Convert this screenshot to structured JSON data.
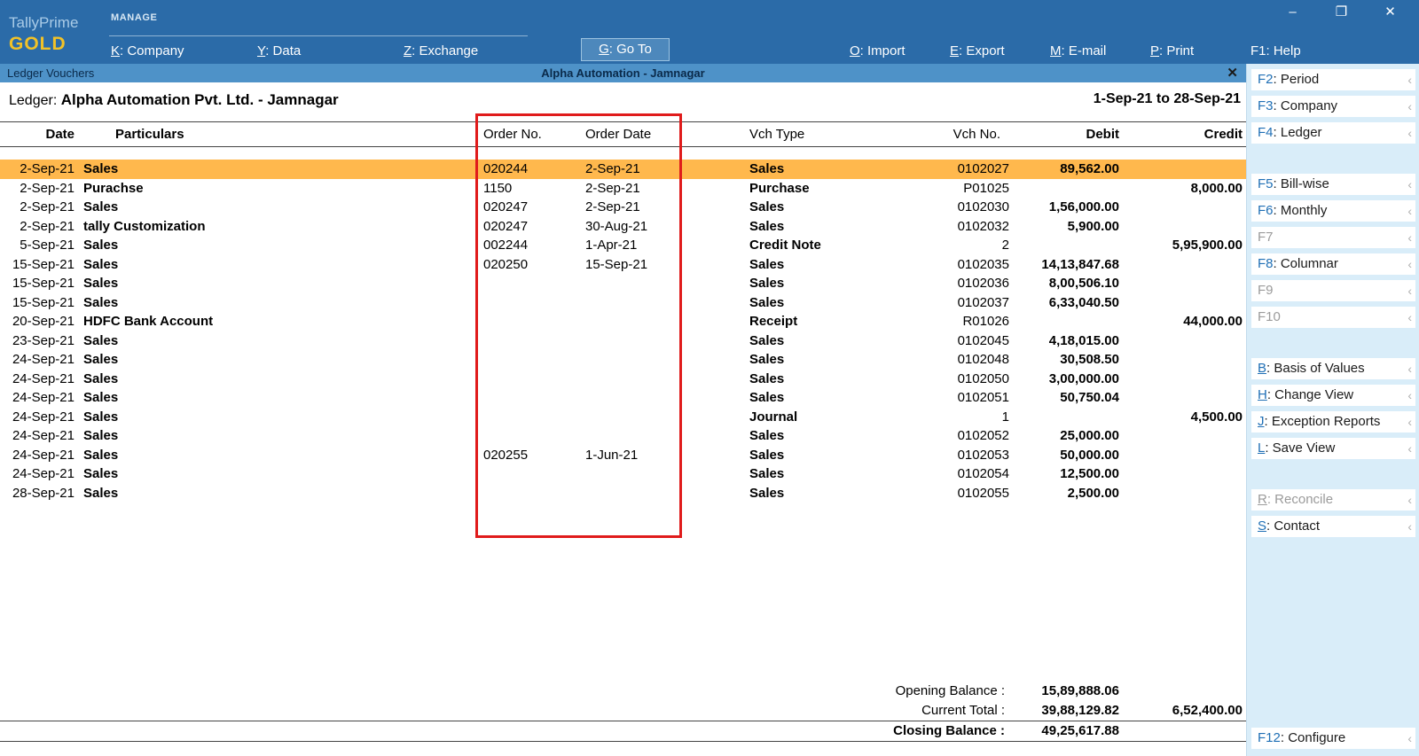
{
  "topbar": {
    "brand": {
      "name": "TallyPrime",
      "edition": "GOLD"
    },
    "section_label": "MANAGE",
    "left_menu": [
      {
        "key": "K",
        "label": "Company"
      },
      {
        "key": "Y",
        "label": "Data"
      },
      {
        "key": "Z",
        "label": "Exchange"
      }
    ],
    "goto": {
      "key": "G",
      "label": "Go To"
    },
    "right_menu": [
      {
        "key": "O",
        "label": "Import"
      },
      {
        "key": "E",
        "label": "Export"
      },
      {
        "key": "M",
        "label": "E-mail"
      },
      {
        "key": "P",
        "label": "Print"
      },
      {
        "key": "F1",
        "label": "Help"
      }
    ]
  },
  "window_controls": {
    "minimize": "–",
    "maximize": "❐",
    "close": "✕"
  },
  "titlebar": {
    "left": "Ledger Vouchers",
    "center": "Alpha Automation - Jamnagar",
    "close": "✕"
  },
  "report": {
    "ledger_label": "Ledger:",
    "ledger_name": "Alpha Automation Pvt. Ltd. - Jamnagar",
    "period": "1-Sep-21 to 28-Sep-21",
    "columns": [
      "Date",
      "Particulars",
      "Order No.",
      "Order Date",
      "Vch Type",
      "Vch No.",
      "Debit",
      "Credit"
    ],
    "rows": [
      {
        "date": "2-Sep-21",
        "particulars": "Sales",
        "order_no": "020244",
        "order_date": "2-Sep-21",
        "vch_type": "Sales",
        "vch_no": "0102027",
        "debit": "89,562.00",
        "credit": "",
        "highlighted": true
      },
      {
        "date": "2-Sep-21",
        "particulars": "Purachse",
        "order_no": "1150",
        "order_date": "2-Sep-21",
        "vch_type": "Purchase",
        "vch_no": "P01025",
        "debit": "",
        "credit": "8,000.00",
        "highlighted": false
      },
      {
        "date": "2-Sep-21",
        "particulars": "Sales",
        "order_no": "020247",
        "order_date": "2-Sep-21",
        "vch_type": "Sales",
        "vch_no": "0102030",
        "debit": "1,56,000.00",
        "credit": "",
        "highlighted": false
      },
      {
        "date": "2-Sep-21",
        "particulars": "tally Customization",
        "order_no": "020247",
        "order_date": "30-Aug-21",
        "vch_type": "Sales",
        "vch_no": "0102032",
        "debit": "5,900.00",
        "credit": "",
        "highlighted": false
      },
      {
        "date": "5-Sep-21",
        "particulars": "Sales",
        "order_no": "002244",
        "order_date": "1-Apr-21",
        "vch_type": "Credit Note",
        "vch_no": "2",
        "debit": "",
        "credit": "5,95,900.00",
        "highlighted": false
      },
      {
        "date": "15-Sep-21",
        "particulars": "Sales",
        "order_no": "020250",
        "order_date": "15-Sep-21",
        "vch_type": "Sales",
        "vch_no": "0102035",
        "debit": "14,13,847.68",
        "credit": "",
        "highlighted": false
      },
      {
        "date": "15-Sep-21",
        "particulars": "Sales",
        "order_no": "",
        "order_date": "",
        "vch_type": "Sales",
        "vch_no": "0102036",
        "debit": "8,00,506.10",
        "credit": "",
        "highlighted": false
      },
      {
        "date": "15-Sep-21",
        "particulars": "Sales",
        "order_no": "",
        "order_date": "",
        "vch_type": "Sales",
        "vch_no": "0102037",
        "debit": "6,33,040.50",
        "credit": "",
        "highlighted": false
      },
      {
        "date": "20-Sep-21",
        "particulars": "HDFC Bank Account",
        "order_no": "",
        "order_date": "",
        "vch_type": "Receipt",
        "vch_no": "R01026",
        "debit": "",
        "credit": "44,000.00",
        "highlighted": false
      },
      {
        "date": "23-Sep-21",
        "particulars": "Sales",
        "order_no": "",
        "order_date": "",
        "vch_type": "Sales",
        "vch_no": "0102045",
        "debit": "4,18,015.00",
        "credit": "",
        "highlighted": false
      },
      {
        "date": "24-Sep-21",
        "particulars": "Sales",
        "order_no": "",
        "order_date": "",
        "vch_type": "Sales",
        "vch_no": "0102048",
        "debit": "30,508.50",
        "credit": "",
        "highlighted": false
      },
      {
        "date": "24-Sep-21",
        "particulars": "Sales",
        "order_no": "",
        "order_date": "",
        "vch_type": "Sales",
        "vch_no": "0102050",
        "debit": "3,00,000.00",
        "credit": "",
        "highlighted": false
      },
      {
        "date": "24-Sep-21",
        "particulars": "Sales",
        "order_no": "",
        "order_date": "",
        "vch_type": "Sales",
        "vch_no": "0102051",
        "debit": "50,750.04",
        "credit": "",
        "highlighted": false
      },
      {
        "date": "24-Sep-21",
        "particulars": "Sales",
        "order_no": "",
        "order_date": "",
        "vch_type": "Journal",
        "vch_no": "1",
        "debit": "",
        "credit": "4,500.00",
        "highlighted": false
      },
      {
        "date": "24-Sep-21",
        "particulars": "Sales",
        "order_no": "",
        "order_date": "",
        "vch_type": "Sales",
        "vch_no": "0102052",
        "debit": "25,000.00",
        "credit": "",
        "highlighted": false
      },
      {
        "date": "24-Sep-21",
        "particulars": "Sales",
        "order_no": "020255",
        "order_date": "1-Jun-21",
        "vch_type": "Sales",
        "vch_no": "0102053",
        "debit": "50,000.00",
        "credit": "",
        "highlighted": false
      },
      {
        "date": "24-Sep-21",
        "particulars": "Sales",
        "order_no": "",
        "order_date": "",
        "vch_type": "Sales",
        "vch_no": "0102054",
        "debit": "12,500.00",
        "credit": "",
        "highlighted": false
      },
      {
        "date": "28-Sep-21",
        "particulars": "Sales",
        "order_no": "",
        "order_date": "",
        "vch_type": "Sales",
        "vch_no": "0102055",
        "debit": "2,500.00",
        "credit": "",
        "highlighted": false
      }
    ],
    "totals": {
      "opening": {
        "label": "Opening Balance :",
        "debit": "15,89,888.06",
        "credit": ""
      },
      "current": {
        "label": "Current Total :",
        "debit": "39,88,129.82",
        "credit": "6,52,400.00"
      },
      "closing": {
        "label": "Closing Balance :",
        "debit": "49,25,617.88",
        "credit": ""
      }
    }
  },
  "annotation": {
    "color": "#e01b1b",
    "purpose": "highlight-order-no-and-order-date-columns"
  },
  "sidebar": {
    "groups": [
      {
        "items": [
          {
            "key": "F2",
            "label": "Period",
            "enabled": true
          },
          {
            "key": "F3",
            "label": "Company",
            "enabled": true
          },
          {
            "key": "F4",
            "label": "Ledger",
            "enabled": true
          }
        ]
      },
      {
        "items": [
          {
            "key": "F5",
            "label": "Bill-wise",
            "enabled": true
          },
          {
            "key": "F6",
            "label": "Monthly",
            "enabled": true
          },
          {
            "key": "F7",
            "label": "",
            "enabled": false
          },
          {
            "key": "F8",
            "label": "Columnar",
            "enabled": true
          },
          {
            "key": "F9",
            "label": "",
            "enabled": false
          },
          {
            "key": "F10",
            "label": "",
            "enabled": false
          }
        ]
      },
      {
        "items": [
          {
            "key": "B",
            "label": "Basis of Values",
            "enabled": true
          },
          {
            "key": "H",
            "label": "Change View",
            "enabled": true
          },
          {
            "key": "J",
            "label": "Exception Reports",
            "enabled": true
          },
          {
            "key": "L",
            "label": "Save View",
            "enabled": true
          }
        ]
      },
      {
        "items": [
          {
            "key": "R",
            "label": "Reconcile",
            "enabled": false
          },
          {
            "key": "S",
            "label": "Contact",
            "enabled": true
          }
        ]
      }
    ],
    "bottom_item": {
      "key": "F12",
      "label": "Configure",
      "enabled": true
    },
    "chevron": "‹"
  }
}
